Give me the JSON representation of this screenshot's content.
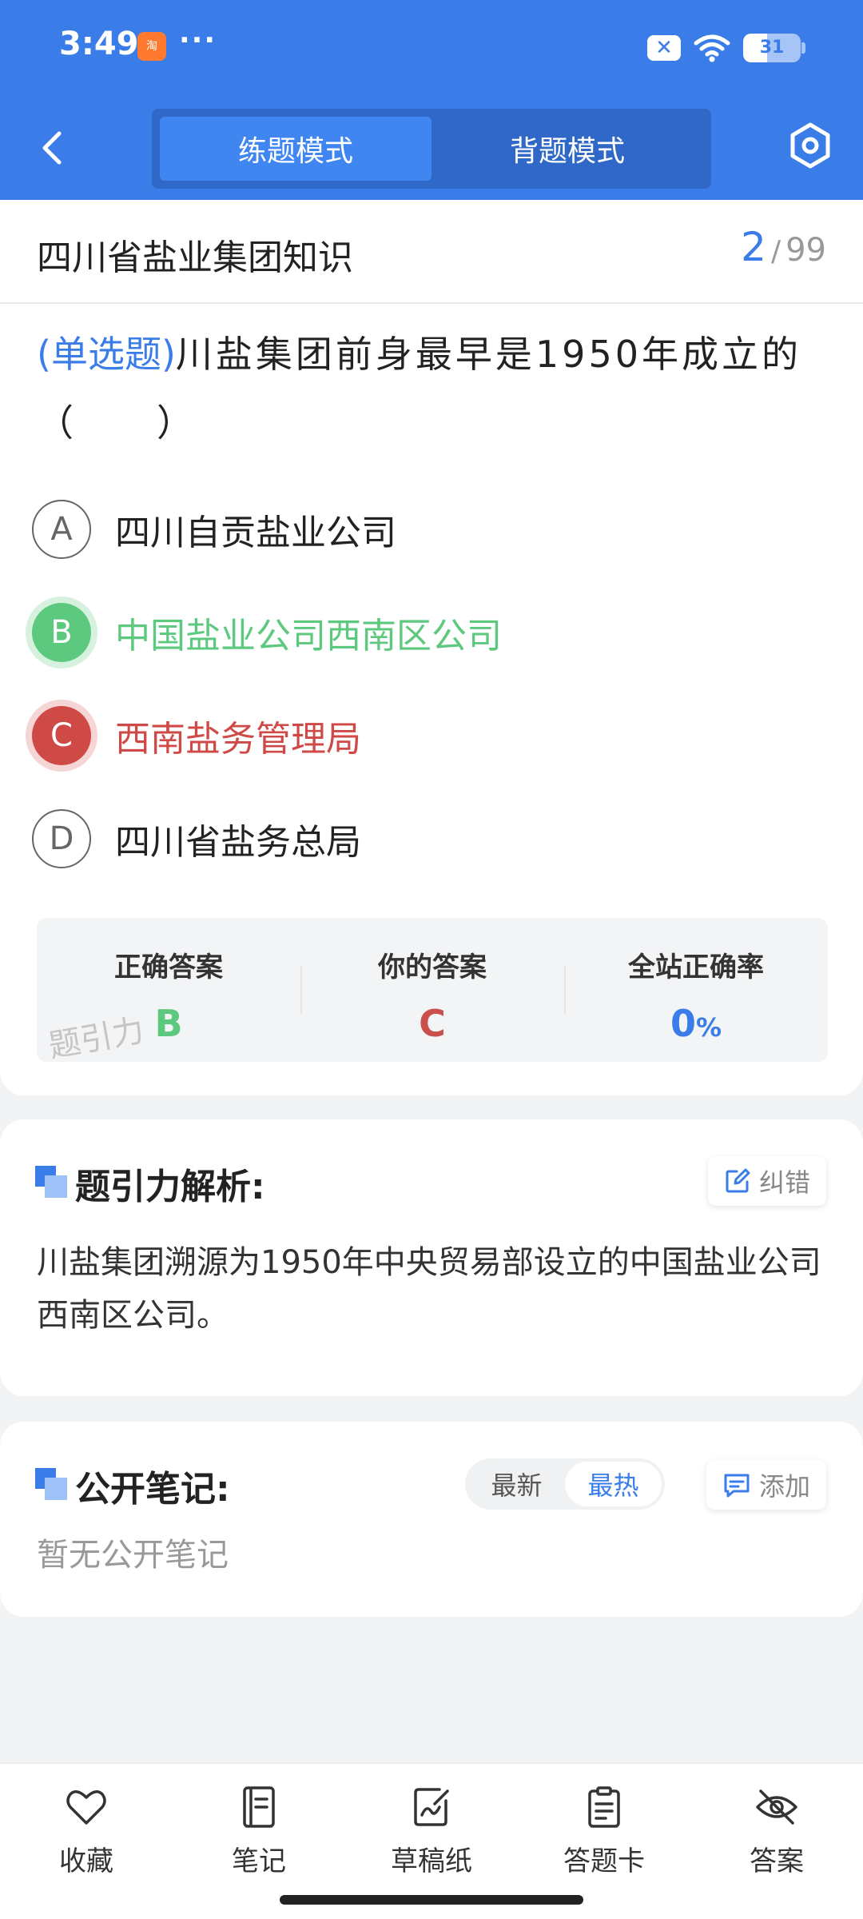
{
  "status": {
    "time": "3:49",
    "app_icon_glyph": "淘",
    "dots": "···",
    "close_glyph": "✕",
    "battery": "31"
  },
  "header": {
    "tabs": [
      {
        "label": "练题模式",
        "active": true
      },
      {
        "label": "背题模式",
        "active": false
      }
    ]
  },
  "question": {
    "topic": "四川省盐业集团知识",
    "current": "2",
    "separator": "/",
    "total": "99",
    "type_label": "(单选题)",
    "text": "川盐集团前身最早是1950年成立的（　　）",
    "options": [
      {
        "letter": "A",
        "text": "四川自贡盐业公司",
        "state": "normal"
      },
      {
        "letter": "B",
        "text": "中国盐业公司西南区公司",
        "state": "correct"
      },
      {
        "letter": "C",
        "text": "西南盐务管理局",
        "state": "wrong"
      },
      {
        "letter": "D",
        "text": "四川省盐务总局",
        "state": "normal"
      }
    ]
  },
  "answer_summary": {
    "correct_label": "正确答案",
    "correct_value": "B",
    "yours_label": "你的答案",
    "yours_value": "C",
    "rate_label": "全站正确率",
    "rate_value": "0",
    "rate_unit": "%",
    "watermark": "题引力"
  },
  "analysis": {
    "title": "题引力解析:",
    "report_label": "纠错",
    "body": "川盐集团溯源为1950年中央贸易部设立的中国盐业公司西南区公司。"
  },
  "notes": {
    "title": "公开笔记:",
    "sort_newest": "最新",
    "sort_hottest": "最热",
    "add_label": "添加",
    "empty_text": "暂无公开笔记"
  },
  "bottom_bar": {
    "favorite": "收藏",
    "notes": "笔记",
    "scratch": "草稿纸",
    "answer_sheet": "答题卡",
    "answer": "答案"
  },
  "colors": {
    "brand": "#3a7de8",
    "correct": "#5dc97f",
    "wrong": "#cf4a46"
  }
}
